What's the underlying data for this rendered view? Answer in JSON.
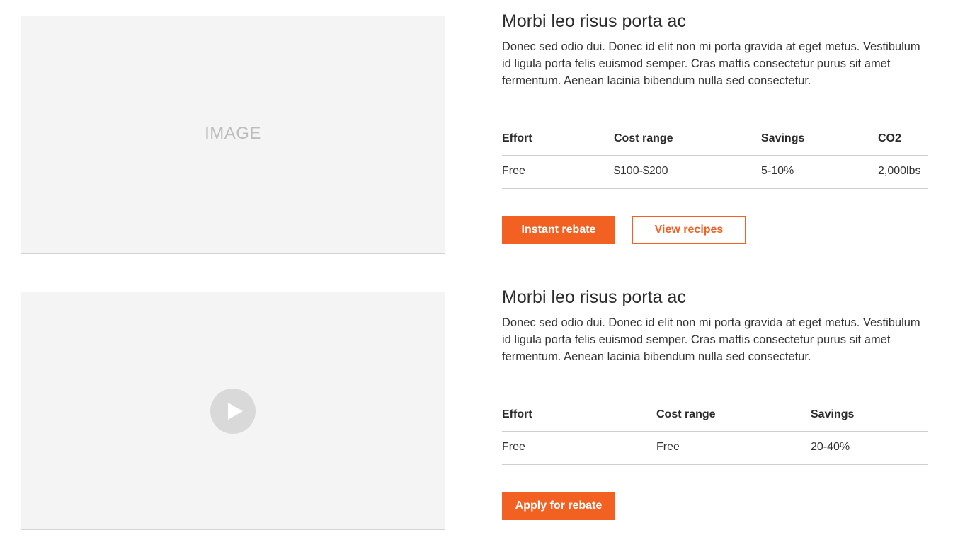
{
  "items": [
    {
      "media": {
        "type": "image",
        "label": "IMAGE"
      },
      "title": "Morbi leo risus porta ac",
      "description": "Donec sed odio dui. Donec id elit non mi porta gravida at eget metus. Vestibulum id ligula porta felis euismod semper. Cras mattis consectetur purus sit amet fermentum. Aenean lacinia bibendum nulla sed consectetur.",
      "table": {
        "headers": [
          "Effort",
          "Cost range",
          "Savings",
          "CO2"
        ],
        "row": [
          "Free",
          "$100-$200",
          "5-10%",
          "2,000lbs"
        ]
      },
      "buttons": [
        {
          "label": "Instant rebate",
          "style": "primary"
        },
        {
          "label": "View recipes",
          "style": "outline"
        }
      ]
    },
    {
      "media": {
        "type": "video",
        "icon": "play-icon"
      },
      "title": "Morbi leo risus porta ac",
      "description": "Donec sed odio dui. Donec id elit non mi porta gravida at eget metus. Vestibulum id ligula porta felis euismod semper. Cras mattis consectetur purus sit amet fermentum. Aenean lacinia bibendum nulla sed consectetur.",
      "table": {
        "headers": [
          "Effort",
          "Cost range",
          "Savings"
        ],
        "row": [
          "Free",
          "Free",
          "20-40%"
        ]
      },
      "buttons": [
        {
          "label": "Apply for rebate",
          "style": "primary"
        }
      ]
    }
  ],
  "colors": {
    "accent": "#f26122",
    "placeholder_bg": "#f4f4f4",
    "placeholder_text": "#bdbdbd",
    "divider": "#cfcfcf"
  }
}
